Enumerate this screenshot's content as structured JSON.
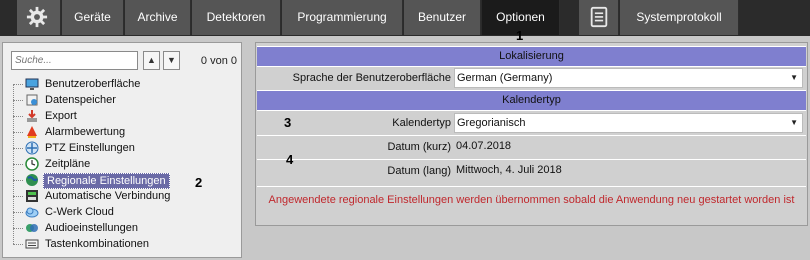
{
  "topbar": {
    "tabs": [
      "Geräte",
      "Archive",
      "Detektoren",
      "Programmierung",
      "Benutzer",
      "Optionen"
    ],
    "active": "Optionen",
    "syslog": "Systemprotokoll"
  },
  "markers": {
    "m1": "1",
    "m2": "2",
    "m3": "3",
    "m4": "4"
  },
  "sidebar": {
    "search_placeholder": "Suche...",
    "up": "▲",
    "down": "▼",
    "count": "0 von 0",
    "items": [
      {
        "label": "Benutzeroberfläche",
        "icon": "monitor-icon"
      },
      {
        "label": "Datenspeicher",
        "icon": "storage-icon"
      },
      {
        "label": "Export",
        "icon": "export-icon"
      },
      {
        "label": "Alarmbewertung",
        "icon": "alarm-icon"
      },
      {
        "label": "PTZ Einstellungen",
        "icon": "ptz-icon"
      },
      {
        "label": "Zeitpläne",
        "icon": "schedule-icon"
      },
      {
        "label": "Regionale Einstellungen",
        "icon": "globe-icon"
      },
      {
        "label": "Automatische Verbindung",
        "icon": "connection-icon"
      },
      {
        "label": "C-Werk Cloud",
        "icon": "cloud-icon"
      },
      {
        "label": "Audioeinstellungen",
        "icon": "audio-icon"
      },
      {
        "label": "Tastenkombinationen",
        "icon": "keyboard-icon"
      }
    ],
    "selected_index": 6
  },
  "panel": {
    "section_localization": "Lokalisierung",
    "ui_language_label": "Sprache der Benutzeroberfläche",
    "ui_language_value": "German (Germany)",
    "section_calendar": "Kalendertyp",
    "calendar_type_label": "Kalendertyp",
    "calendar_type_value": "Gregorianisch",
    "date_short_label": "Datum (kurz)",
    "date_short_value": "04.07.2018",
    "date_long_label": "Datum (lang)",
    "date_long_value": "Mittwoch, 4. Juli 2018",
    "note": "Angewendete regionale Einstellungen werden übernommen sobald die Anwendung neu gestartet worden ist"
  },
  "colors": {
    "section_header": "#7f7fcf",
    "note_text": "#c0282d",
    "selection": "#6a6aa6"
  }
}
